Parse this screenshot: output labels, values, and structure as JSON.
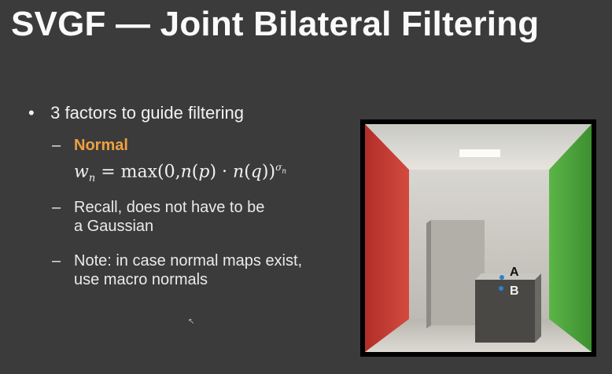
{
  "slide": {
    "title": "SVGF — Joint Bilateral Filtering",
    "bullet": "3 factors to guide filtering",
    "sub_items": [
      {
        "label": "Normal",
        "formula": "w_n = max(0, n(p) · n(q))^σ_n"
      },
      {
        "line1": "Recall, does not have to be",
        "line2": "a Gaussian"
      },
      {
        "line1": "Note: in case normal maps exist,",
        "line2": "use macro normals"
      }
    ],
    "figure_labels": {
      "a": "A",
      "b": "B"
    }
  },
  "colors": {
    "background": "#3b3b3b",
    "accent_orange": "#f0a040",
    "wall_red": "#c7362f",
    "wall_green": "#4aa33a",
    "point_blue": "#2f7fd6"
  }
}
